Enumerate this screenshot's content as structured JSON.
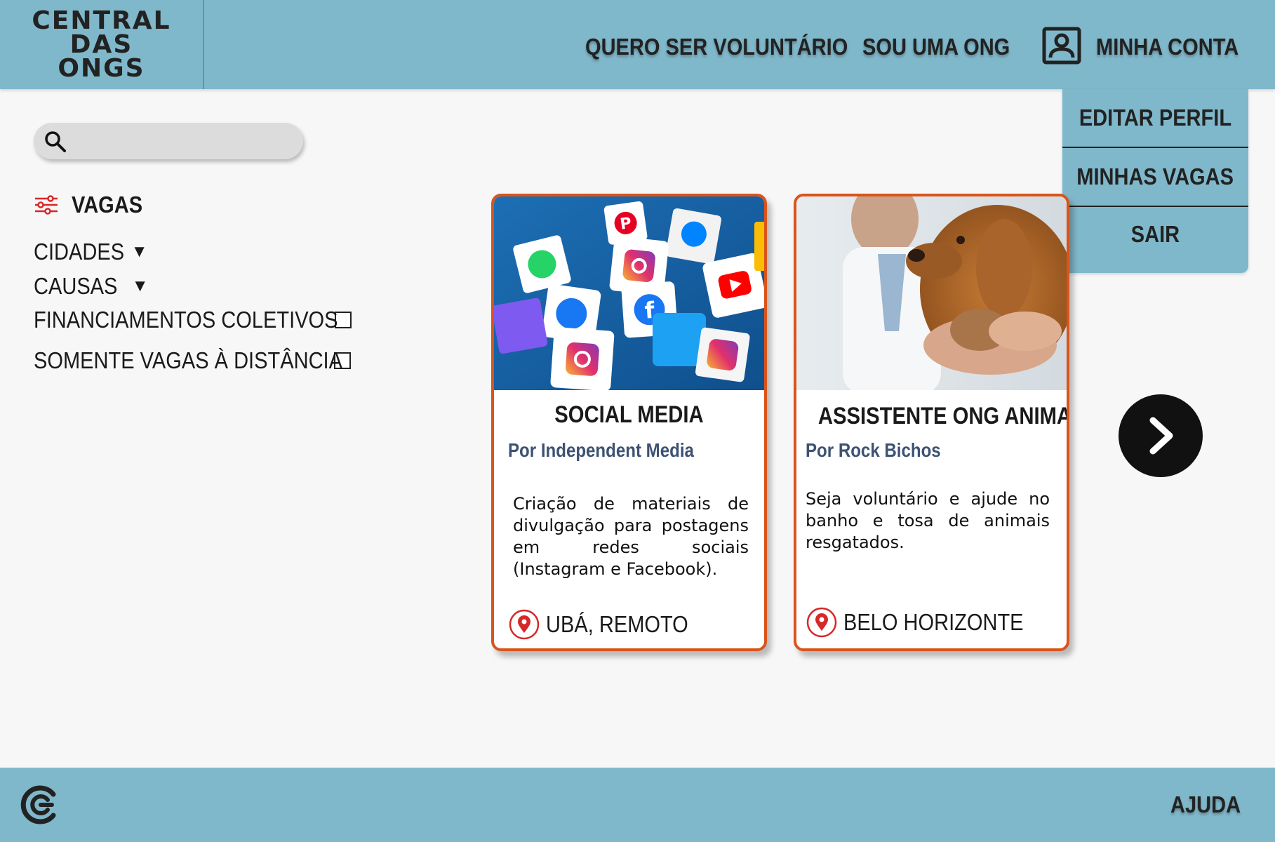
{
  "header": {
    "logo_lines": [
      "CENTRAL",
      "DAS",
      "ONGS"
    ],
    "nav": {
      "volunteer": "QUERO SER VOLUNTÁRIO",
      "ong": "SOU UMA ONG",
      "account": "MINHA CONTA"
    }
  },
  "account_menu": {
    "items": [
      "EDITAR PERFIL",
      "MINHAS VAGAS",
      "SAIR"
    ]
  },
  "search": {
    "placeholder": "",
    "icon": "search-icon"
  },
  "filters": {
    "title": "VAGAS",
    "cities": "CIDADES",
    "causes": "CAUSAS",
    "crowdfunding": "FINANCIAMENTOS COLETIVOS",
    "remote_only": "SOMENTE VAGAS À DISTÂNCIA"
  },
  "cards": [
    {
      "title": "SOCIAL MEDIA",
      "org": "Por Independent Media",
      "description": "Criação de materiais de divulgação para postagens em redes sociais (Instagram e Facebook).",
      "location": "UBÁ, REMOTO"
    },
    {
      "title": "ASSISTENTE ONG ANIMAL",
      "org": "Por Rock Bichos",
      "description": "Seja voluntário e ajude no banho e tosa de animais resgatados.",
      "location": "BELO HORIZONTE"
    }
  ],
  "footer": {
    "help": "AJUDA"
  },
  "colors": {
    "header_bg": "#80b8cb",
    "card_border": "#d9541b",
    "org_text": "#3d5273",
    "pin": "#d62828",
    "page_bg": "#f7f7f7"
  }
}
